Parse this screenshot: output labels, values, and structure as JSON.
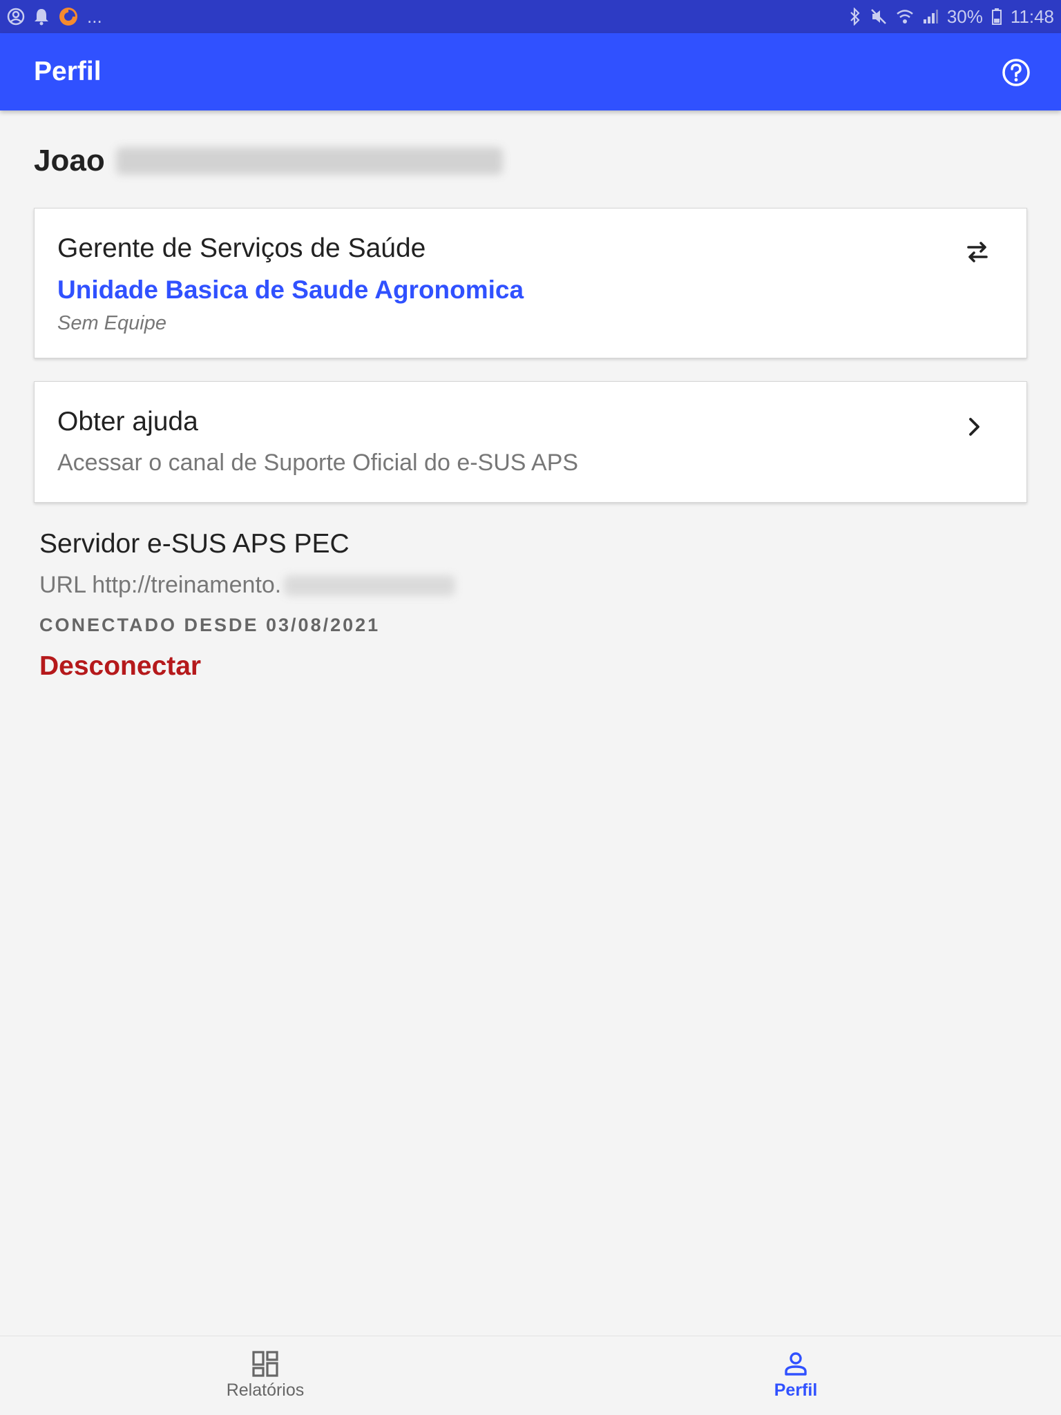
{
  "status_bar": {
    "left_icons": [
      "account-circle-icon",
      "bell-icon",
      "app-pie-icon"
    ],
    "more": "...",
    "battery": "30%",
    "time": "11:48"
  },
  "app_bar": {
    "title": "Perfil",
    "help_icon": "help-circle-icon"
  },
  "user": {
    "first_name": "Joao"
  },
  "role_card": {
    "title": "Gerente de Serviços de Saúde",
    "unit": "Unidade Basica de Saude Agronomica",
    "team": "Sem Equipe",
    "action_icon": "swap-icon"
  },
  "help_card": {
    "title": "Obter ajuda",
    "subtitle": "Acessar o canal de Suporte Oficial do e-SUS APS",
    "action_icon": "chevron-right-icon"
  },
  "server": {
    "title": "Servidor e-SUS APS PEC",
    "url_prefix": "URL http://treinamento.",
    "connected_since": "CONECTADO DESDE 03/08/2021",
    "disconnect_label": "Desconectar"
  },
  "bottom_nav": {
    "items": [
      {
        "label": "Relatórios",
        "icon": "dashboard-icon",
        "active": false
      },
      {
        "label": "Perfil",
        "icon": "person-icon",
        "active": true
      }
    ]
  },
  "colors": {
    "status_bar": "#2d3bc4",
    "primary": "#3051ff",
    "danger": "#b5191b",
    "background": "#f4f4f4"
  }
}
